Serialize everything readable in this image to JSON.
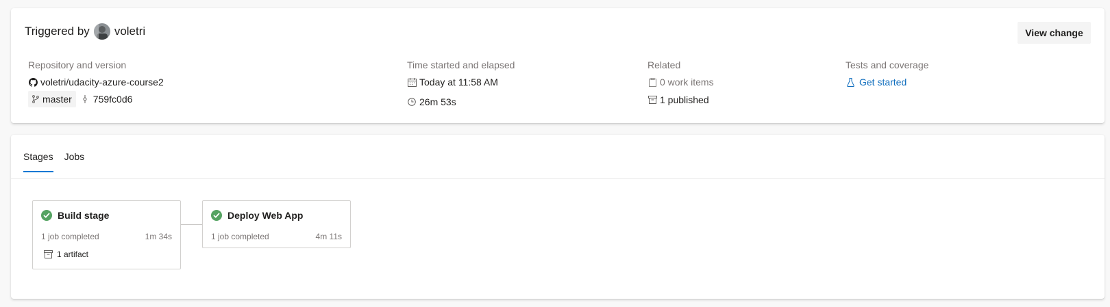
{
  "summary": {
    "triggered_prefix": "Triggered by",
    "triggered_user": "voletri",
    "view_change_label": "View change",
    "repository": {
      "label": "Repository and version",
      "repo_name": "voletri/udacity-azure-course2",
      "branch": "master",
      "commit": "759fc0d6"
    },
    "time": {
      "label": "Time started and elapsed",
      "started": "Today at 11:58 AM",
      "elapsed": "26m 53s"
    },
    "related": {
      "label": "Related",
      "work_items": "0 work items",
      "published": "1 published"
    },
    "tests": {
      "label": "Tests and coverage",
      "link": "Get started"
    }
  },
  "tabs": [
    {
      "label": "Stages",
      "active": true
    },
    {
      "label": "Jobs",
      "active": false
    }
  ],
  "stages": [
    {
      "name": "Build stage",
      "status": "succeeded",
      "jobs": "1 job completed",
      "duration": "1m 34s",
      "artifacts": "1 artifact"
    },
    {
      "name": "Deploy Web App",
      "status": "succeeded",
      "jobs": "1 job completed",
      "duration": "4m 11s"
    }
  ],
  "colors": {
    "accent": "#0078d4",
    "link": "#106ebe",
    "success": "#55a362"
  }
}
